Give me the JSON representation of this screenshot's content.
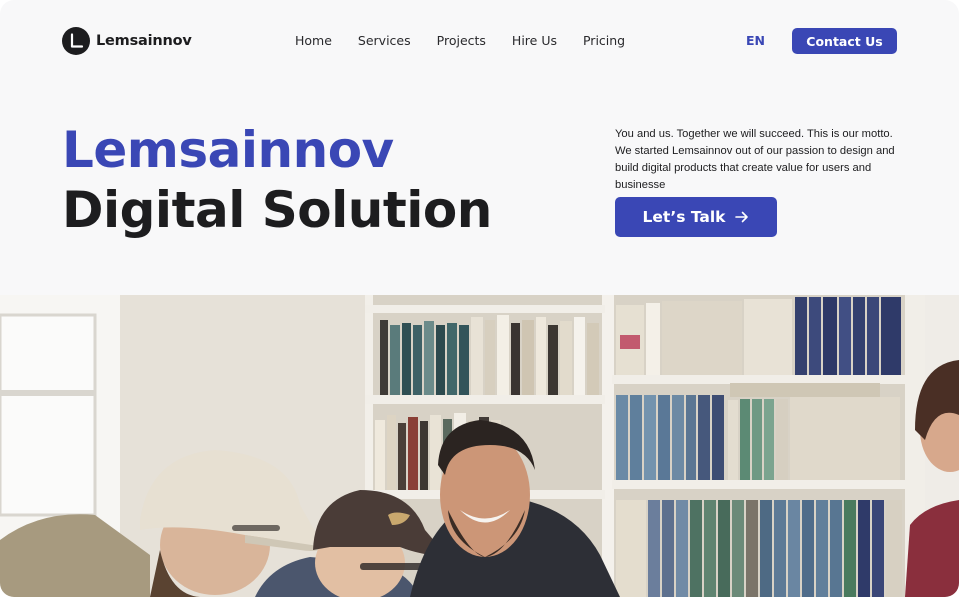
{
  "brand": {
    "name": "Lemsainnov",
    "logo_icon": "lemsainnov-logo-icon"
  },
  "nav": {
    "items": [
      {
        "label": "Home"
      },
      {
        "label": "Services"
      },
      {
        "label": "Projects"
      },
      {
        "label": "Hire Us"
      },
      {
        "label": "Pricing"
      }
    ],
    "language": "EN",
    "contact_label": "Contact Us"
  },
  "hero": {
    "title_line1": "Lemsainnov",
    "title_line2": "Digital Solution",
    "description": "You and us. Together we will succeed. This is our motto. We started Lemsainnov out of our passion to design and build digital products that create value for users and businesse",
    "cta_label": "Let’s Talk",
    "cta_icon": "arrow-right-icon"
  },
  "image": {
    "subject": "team-photo"
  },
  "colors": {
    "accent": "#3a47b5",
    "text": "#1d1d1f",
    "background": "#f8f8f9"
  }
}
